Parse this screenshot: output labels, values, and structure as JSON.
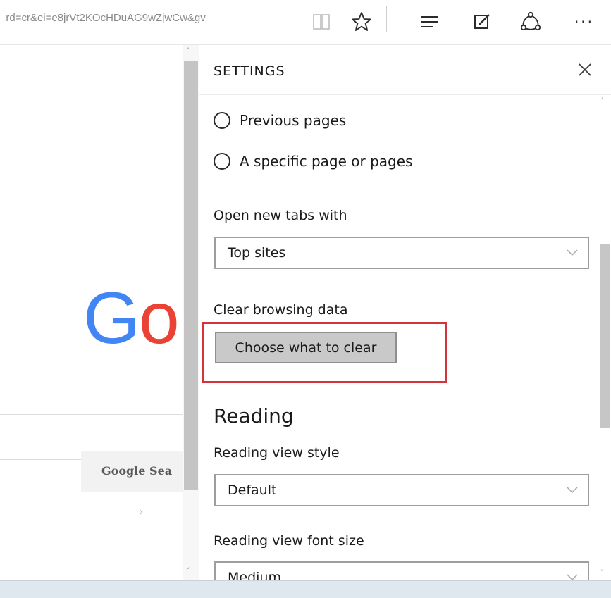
{
  "toolbar": {
    "url_fragment": "_rd=cr&ei=e8jrVt2KOcHDuAG9wZjwCw&gv",
    "icons": [
      "reading-view-icon",
      "favorite-star-icon",
      "hub-icon",
      "web-note-icon",
      "share-icon",
      "more-icon"
    ],
    "more_label": "···"
  },
  "page": {
    "logo_letters": [
      "G",
      "o"
    ],
    "logo_colors": [
      "#4285f4",
      "#ea4335"
    ],
    "search_button_label": "Google Sea"
  },
  "settings": {
    "title": "SETTINGS",
    "startup_options": [
      {
        "label": "Previous pages",
        "selected": false
      },
      {
        "label": "A specific page or pages",
        "selected": false
      }
    ],
    "new_tabs_label": "Open new tabs with",
    "new_tabs_value": "Top sites",
    "clear_data_label": "Clear browsing data",
    "clear_button_label": "Choose what to clear",
    "reading_heading": "Reading",
    "reading_style_label": "Reading view style",
    "reading_style_value": "Default",
    "reading_font_label": "Reading view font size",
    "reading_font_value": "Medium"
  },
  "colors": {
    "highlight": "#d5333c",
    "button_bg": "#c9c9c9"
  }
}
